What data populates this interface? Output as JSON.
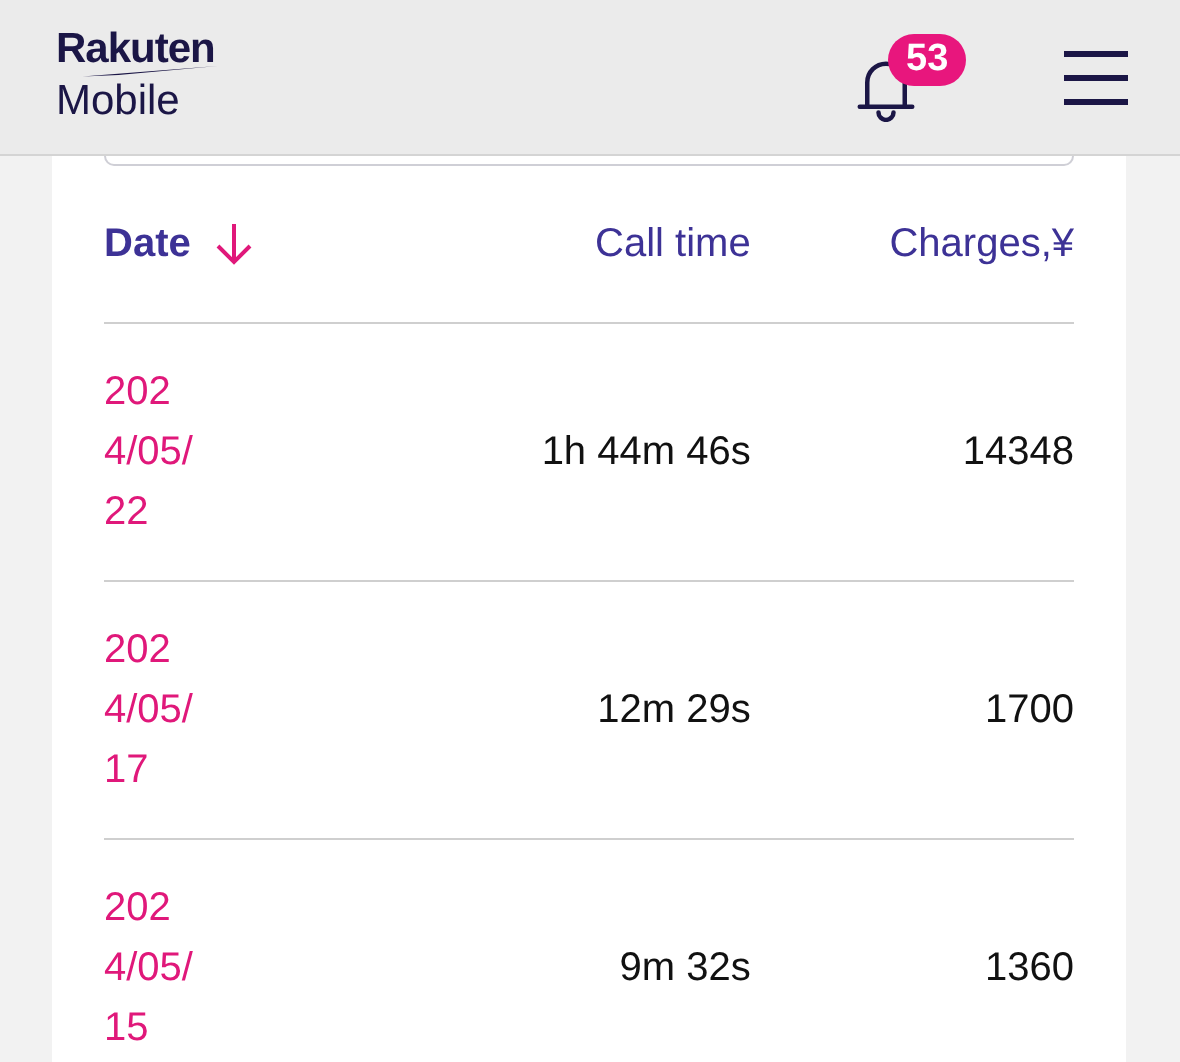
{
  "header": {
    "logo": {
      "brand": "Rakuten",
      "product": "Mobile"
    },
    "notifications": {
      "count": "53"
    }
  },
  "table": {
    "columns": [
      {
        "label": "Date",
        "sorted": true
      },
      {
        "label": "Call time",
        "sorted": false
      },
      {
        "label": "Charges,¥",
        "sorted": false
      }
    ],
    "rows": [
      {
        "date": "2024/05/22",
        "call_time": "1h 44m 46s",
        "charges": "14348"
      },
      {
        "date": "2024/05/17",
        "call_time": "12m 29s",
        "charges": "1700"
      },
      {
        "date": "2024/05/15",
        "call_time": "9m 32s",
        "charges": "1360"
      }
    ]
  }
}
